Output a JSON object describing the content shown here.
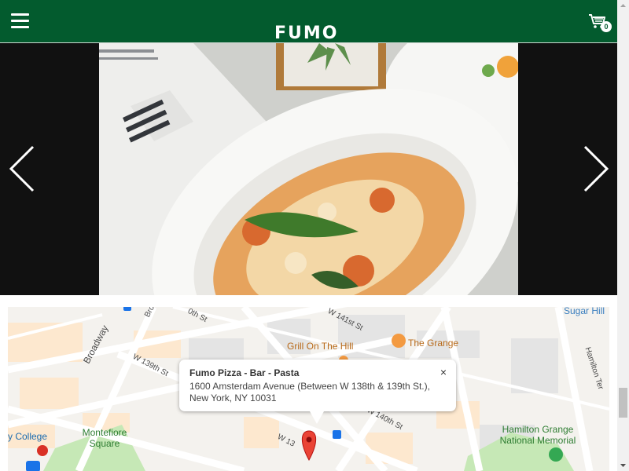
{
  "header": {
    "logo": "FUMO",
    "cart_count": "0",
    "colors": {
      "background": "#035b2e",
      "text": "#ffffff"
    }
  },
  "carousel": {
    "slide": "baked-pasta-photo",
    "prev_icon": "chevron-left-icon",
    "next_icon": "chevron-right-icon"
  },
  "map": {
    "info_window": {
      "title": "Fumo Pizza - Bar - Pasta",
      "address": "1600 Amsterdam Avenue (Between W 138th & 139th St.), New York, NY 10031",
      "close": "×"
    },
    "places": [
      "Sugar Hill",
      "Grill On The Hill",
      "The Grange",
      "Montefiore Square",
      "Hamilton Grange National Memorial",
      "y College",
      "Broadway",
      "Hamilton Ter"
    ],
    "streets": [
      "W 141st St",
      "W 140th St",
      "W 139th St",
      "W 13",
      "Bro",
      "0th St"
    ],
    "colors": {
      "block": "#fdecd9",
      "road": "#ffffff",
      "park": "#c6e8b6",
      "pin": "#ea4335",
      "poi": "#f39a41",
      "water_label": "#1a73e8"
    }
  }
}
